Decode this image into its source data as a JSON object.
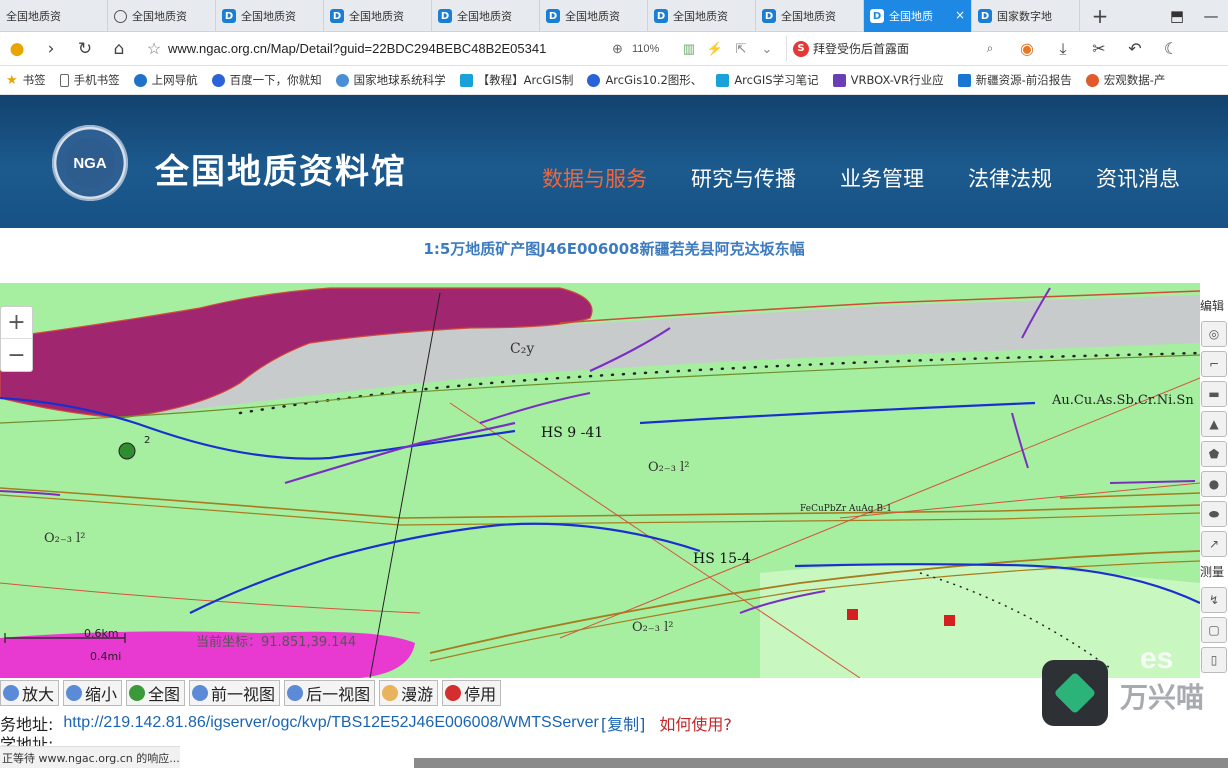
{
  "browser": {
    "tabs": [
      {
        "label": "全国地质资",
        "icon": "none"
      },
      {
        "label": "全国地质资",
        "icon": "globe"
      },
      {
        "label": "全国地质资",
        "icon": "D"
      },
      {
        "label": "全国地质资",
        "icon": "D"
      },
      {
        "label": "全国地质资",
        "icon": "D"
      },
      {
        "label": "全国地质资",
        "icon": "D"
      },
      {
        "label": "全国地质资",
        "icon": "D"
      },
      {
        "label": "全国地质资",
        "icon": "D"
      },
      {
        "label": "全国地质",
        "icon": "D",
        "active": true
      },
      {
        "label": "国家数字地",
        "icon": "D"
      }
    ],
    "new_tab": "+",
    "url": "www.ngac.org.cn/Map/Detail?guid=22BDC294BEBC48B2E05341",
    "zoom": "110%",
    "search_engine": "S",
    "search_text": "拜登受伤后首露面"
  },
  "bookmarks": [
    {
      "label": "书签",
      "icon": "star"
    },
    {
      "label": "手机书签",
      "icon": "phone"
    },
    {
      "label": "上网导航",
      "icon": "e"
    },
    {
      "label": "百度一下，你就知",
      "icon": "paw"
    },
    {
      "label": "国家地球系统科学",
      "icon": "esri"
    },
    {
      "label": "【教程】ArcGIS制",
      "icon": "bili"
    },
    {
      "label": "ArcGis10.2图形、",
      "icon": "paw"
    },
    {
      "label": "ArcGIS学习笔记",
      "icon": "bili"
    },
    {
      "label": "VRBOX-VR行业应",
      "icon": "vr"
    },
    {
      "label": "新疆资源-前沿报告",
      "icon": "doc"
    },
    {
      "label": "宏观数据-产",
      "icon": "hg"
    }
  ],
  "site": {
    "logo_text": "NGA",
    "title": "全国地质资料馆",
    "nav": [
      {
        "label": "数据与服务",
        "active": true
      },
      {
        "label": "研究与传播",
        "active": false
      },
      {
        "label": "业务管理",
        "active": false
      },
      {
        "label": "法律法规",
        "active": false
      },
      {
        "label": "资讯消息",
        "active": false
      }
    ]
  },
  "map": {
    "title": "1:5万地质矿产图J46E006008新疆若羌县阿克达坂东幅",
    "zoom_in": "+",
    "zoom_out": "−",
    "coord_text": "当前坐标：91.851,39.144",
    "scale_km": "0.6km",
    "scale_mi": "0.4mi",
    "labels": {
      "c2y": "C₂y",
      "hs941": "HS 9 -41",
      "hs154": "HS 15-4",
      "o23": "O₂₋₃ l²",
      "o232": "O₂₋₃ l²",
      "o233": "O₂₋₃ l²",
      "elements": "Au.Cu.As.Sb.Cr.Ni.Sn",
      "fecu": "FeCuPbZr AuAg B-1",
      "num2": "2"
    },
    "edit_label": "编辑",
    "measure_label": "测量",
    "esri": "es"
  },
  "tools": [
    {
      "label": "放大",
      "icon": "zoom-in-icon",
      "color": "#5b8ad6"
    },
    {
      "label": "缩小",
      "icon": "zoom-out-icon",
      "color": "#5b8ad6"
    },
    {
      "label": "全图",
      "icon": "globe-icon",
      "color": "#3a9a3a"
    },
    {
      "label": "前一视图",
      "icon": "prev-view-icon",
      "color": "#5b8ad6"
    },
    {
      "label": "后一视图",
      "icon": "next-view-icon",
      "color": "#5b8ad6"
    },
    {
      "label": "漫游",
      "icon": "hand-icon",
      "color": "#e8b35a"
    },
    {
      "label": "停用",
      "icon": "stop-icon",
      "color": "#d32f2f"
    }
  ],
  "service": {
    "label": "务地址:",
    "url": "http://219.142.81.86/igserver/ogc/kvp/TBS12E52J46E006008/WMTSServer",
    "copy": "[复制]",
    "howto": "如何使用?",
    "label2": "学地址:"
  },
  "status": "正等待 www.ngac.org.cn 的响应...",
  "watermark": "万兴喵"
}
